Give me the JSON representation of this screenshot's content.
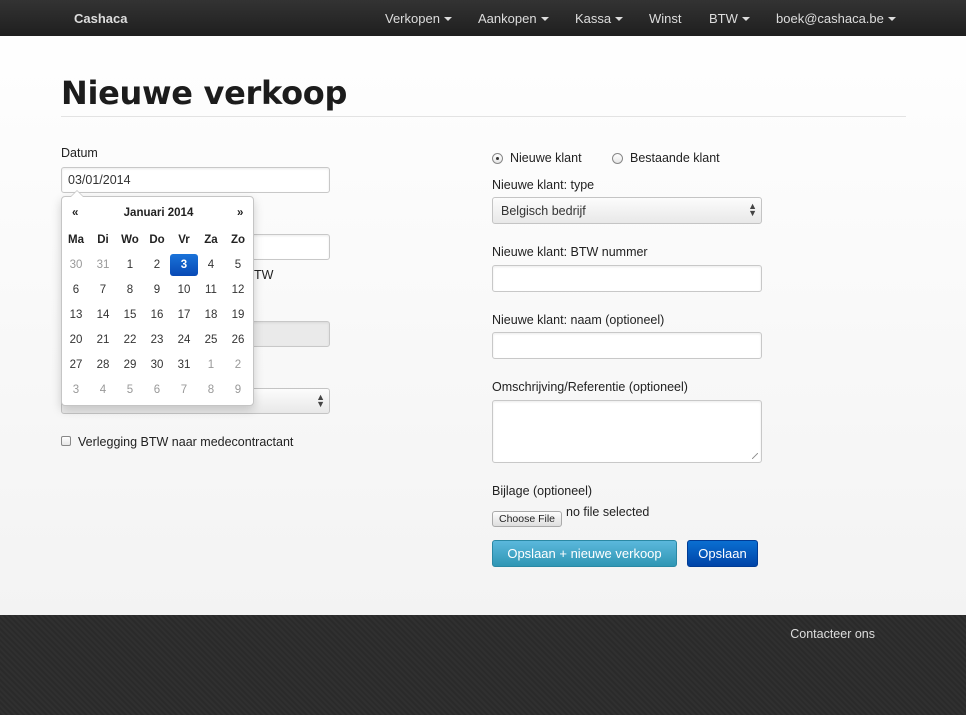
{
  "navbar": {
    "brand": "Cashaca",
    "items": [
      {
        "label": "Verkopen",
        "dropdown": true
      },
      {
        "label": "Aankopen",
        "dropdown": true
      },
      {
        "label": "Kassa",
        "dropdown": true
      },
      {
        "label": "Winst",
        "dropdown": false
      },
      {
        "label": "BTW",
        "dropdown": true
      },
      {
        "label": "boek@cashaca.be",
        "dropdown": true
      }
    ]
  },
  "page": {
    "title": "Nieuwe verkoop"
  },
  "left": {
    "datum_label": "Datum",
    "datum_value": "03/01/2014",
    "partial_label_text": "TW",
    "verlegging_label": "Verlegging BTW naar medecontractant"
  },
  "datepicker": {
    "prev": "«",
    "next": "»",
    "month": "Januari 2014",
    "weekdays": [
      "Ma",
      "Di",
      "Wo",
      "Do",
      "Vr",
      "Za",
      "Zo"
    ],
    "weeks": [
      [
        "30",
        "31",
        "1",
        "2",
        "3",
        "4",
        "5"
      ],
      [
        "6",
        "7",
        "8",
        "9",
        "10",
        "11",
        "12"
      ],
      [
        "13",
        "14",
        "15",
        "16",
        "17",
        "18",
        "19"
      ],
      [
        "20",
        "21",
        "22",
        "23",
        "24",
        "25",
        "26"
      ],
      [
        "27",
        "28",
        "29",
        "30",
        "31",
        "1",
        "2"
      ],
      [
        "3",
        "4",
        "5",
        "6",
        "7",
        "8",
        "9"
      ]
    ],
    "selected": "3"
  },
  "right": {
    "radio_new": "Nieuwe klant",
    "radio_existing": "Bestaande klant",
    "type_label": "Nieuwe klant: type",
    "type_value": "Belgisch bedrijf",
    "btw_label": "Nieuwe klant: BTW nummer",
    "btw_value": "",
    "naam_label": "Nieuwe klant: naam (optioneel)",
    "naam_value": "",
    "omschrijving_label": "Omschrijving/Referentie (optioneel)",
    "omschrijving_value": "",
    "bijlage_label": "Bijlage (optioneel)",
    "choose_file": "Choose File",
    "no_file": "no file selected",
    "save_new_button": "Opslaan + nieuwe verkoop",
    "save_button": "Opslaan"
  },
  "footer": {
    "contact": "Contacteer ons"
  },
  "colors": {
    "navbar": "#222222",
    "primary_button": "#0055cc",
    "info_button": "#49afcd",
    "datepicker_selected": "#0c5fcc"
  }
}
